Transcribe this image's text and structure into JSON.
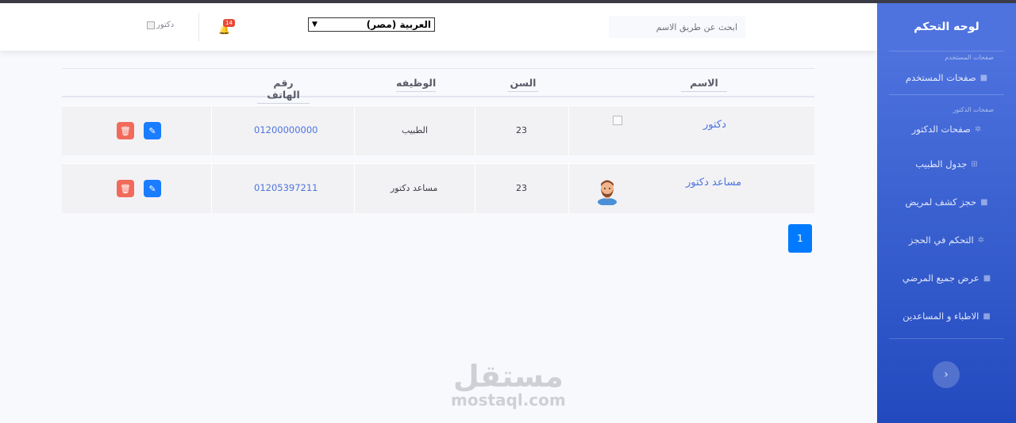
{
  "sidebar": {
    "brand": "لوحه التحكم",
    "heading_user": "صفحات المستخدم",
    "heading_doctor": "صفحات الدكتور",
    "items": [
      {
        "label": "صفحات المستخدم",
        "icon": "folder-icon"
      },
      {
        "label": "صفحات الدكتور",
        "icon": "gear-icon"
      },
      {
        "label": "جدول الطبيب",
        "icon": "table-icon"
      },
      {
        "label": "حجز كشف لمريض",
        "icon": "folder-icon"
      },
      {
        "label": "التحكم في الحجز",
        "icon": "gear-icon"
      },
      {
        "label": "عرض جميع المرضي",
        "icon": "folder-icon"
      },
      {
        "label": "الاطباء و المساعدين",
        "icon": "folder-icon"
      }
    ],
    "toggle_glyph": "‹"
  },
  "header": {
    "search_placeholder": "ابحث عن طريق الاسم",
    "language": "العربية (مصر)",
    "notifications_count": "14",
    "user_alt": "دكتور"
  },
  "table": {
    "headers": {
      "name": "الاسم",
      "age": "السن",
      "job": "الوظيفه",
      "phone": "رقم الهاتف"
    },
    "rows": [
      {
        "name": "دكتور",
        "age": "23",
        "job": "الطبيب",
        "phone": "01200000000"
      },
      {
        "name": "مساعد دكتور",
        "age": "23",
        "job": "مساعد دكتور",
        "phone": "01205397211"
      }
    ]
  },
  "pagination": {
    "current": "1"
  },
  "watermark": {
    "ar": "مستقل",
    "en": "mostaql.com"
  },
  "colors": {
    "primary": "#4e73df",
    "danger": "#e74a3b",
    "edit": "#1a7cff",
    "delete": "#f26a5b"
  }
}
